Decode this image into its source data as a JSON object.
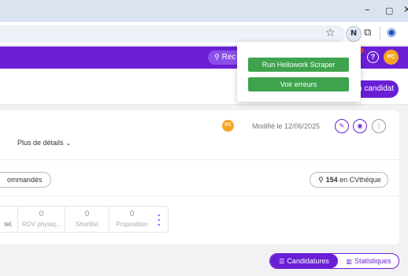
{
  "window": {
    "minimize_icon": "–",
    "maximize_icon": "▢",
    "close_icon": "✕"
  },
  "toolbar": {
    "extension_letter": "N"
  },
  "header": {
    "search_label": "Rec",
    "help_label": "?",
    "avatar_initials": "PC",
    "accent": "#6a1fd6"
  },
  "popup": {
    "run_label": "Run Hellowork Scraper",
    "errors_label": "Voir erreurs",
    "button_color": "#3fa34d"
  },
  "topbar": {
    "candidate_button": "n candidat"
  },
  "card": {
    "owner_initials": "PC",
    "modified": "Modifié le 12/06/2025",
    "details_label": "Plus de détails",
    "recommended_label": "ommandés",
    "cvtheque_count": "154",
    "cvtheque_label": "en CVthèque"
  },
  "stats": [
    {
      "value": "",
      "label": "tel."
    },
    {
      "value": "0",
      "label": "RDV physiq..."
    },
    {
      "value": "0",
      "label": "Shortlist"
    },
    {
      "value": "0",
      "label": "Proposition"
    }
  ],
  "view_toggle": {
    "candidatures_label": "Candidatures",
    "statistiques_label": "Statistiques"
  }
}
